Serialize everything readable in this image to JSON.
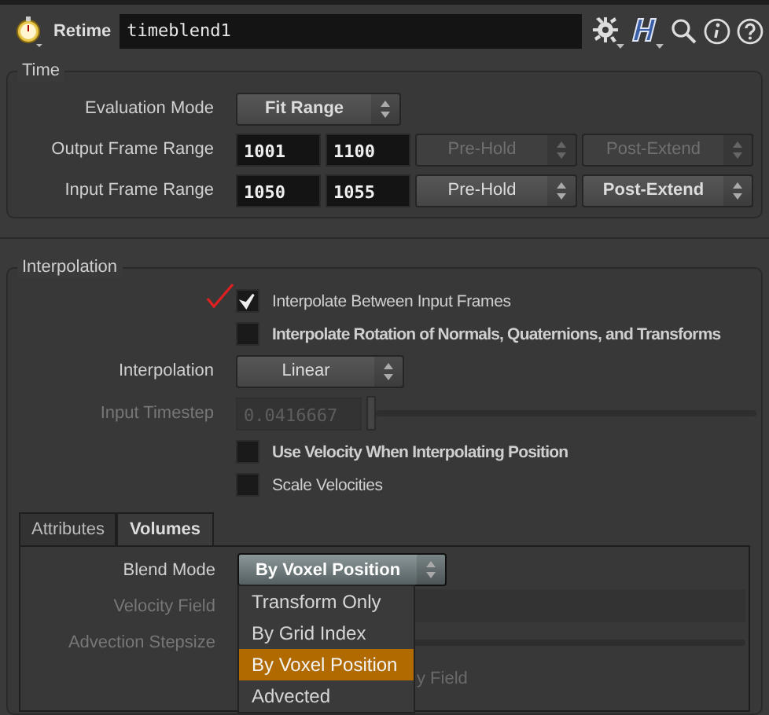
{
  "header": {
    "node_type": "Retime",
    "node_name": "timeblend1"
  },
  "time": {
    "title": "Time",
    "rows": [
      {
        "kind": "menu",
        "label": "Evaluation Mode",
        "value": "Fit Range",
        "modified": true
      },
      {
        "kind": "range",
        "label": "Output Frame Range",
        "start": "1001",
        "end": "1100",
        "pre": "Pre-Hold",
        "post": "Post-Extend",
        "pre_modified": false,
        "post_modified": false,
        "disabled": true
      },
      {
        "kind": "range",
        "label": "Input Frame Range",
        "start": "1050",
        "end": "1055",
        "pre": "Pre-Hold",
        "post": "Post-Extend",
        "pre_modified": false,
        "post_modified": true,
        "disabled": false
      }
    ]
  },
  "interpolation": {
    "title": "Interpolation",
    "rows": [
      {
        "kind": "checkbox",
        "label": "Interpolate Between Input Frames",
        "checked": true,
        "modified": false
      },
      {
        "kind": "checkbox",
        "label": "Interpolate Rotation of Normals, Quaternions, and Transforms",
        "checked": false,
        "modified": true
      },
      {
        "kind": "menu",
        "label": "Interpolation",
        "value": "Linear",
        "modified": false
      },
      {
        "kind": "slider",
        "label": "Input Timestep",
        "value": "0.0416667",
        "level": 0,
        "disabled": true
      },
      {
        "kind": "checkbox",
        "label": "Use Velocity When Interpolating Position",
        "checked": false,
        "modified": true
      },
      {
        "kind": "checkbox",
        "label": "Scale Velocities",
        "checked": false,
        "modified": false
      }
    ],
    "tabs": [
      {
        "label": "Attributes",
        "selected": false
      },
      {
        "label": "Volumes",
        "selected": true
      }
    ],
    "volumes": [
      {
        "kind": "menu",
        "label": "Blend Mode",
        "value": "By Voxel Position",
        "modified": true,
        "open": true,
        "options": [
          {
            "label": "Transform Only",
            "selected": false
          },
          {
            "label": "By Grid Index",
            "selected": false
          },
          {
            "label": "By Voxel Position",
            "selected": true
          },
          {
            "label": "Advected",
            "selected": false
          }
        ]
      },
      {
        "kind": "field",
        "label": "Velocity Field",
        "disabled": true
      },
      {
        "kind": "track",
        "label": "Advection Stepsize",
        "disabled": true
      },
      {
        "kind": "text",
        "text": "y Field",
        "disabled": true
      }
    ]
  }
}
